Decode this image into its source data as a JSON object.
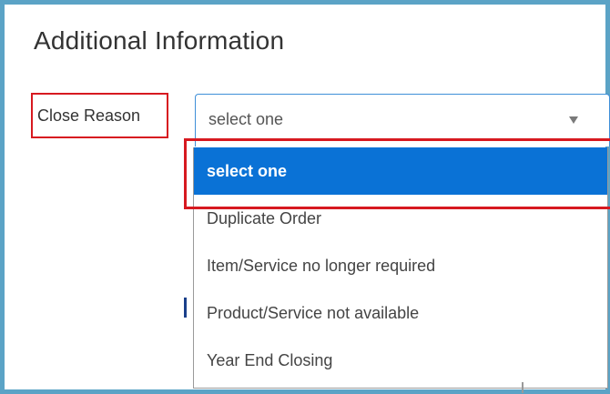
{
  "section": {
    "title": "Additional Information"
  },
  "field": {
    "label": "Close Reason"
  },
  "select": {
    "value": "select one",
    "options": [
      "select one",
      "Duplicate Order",
      "Item/Service no longer required",
      "Product/Service not available",
      "Year End Closing"
    ]
  },
  "colors": {
    "frame_border": "#5ba3c6",
    "highlight": "#d71920",
    "selected_option": "#0a72d6",
    "select_border": "#3f8fd8"
  }
}
